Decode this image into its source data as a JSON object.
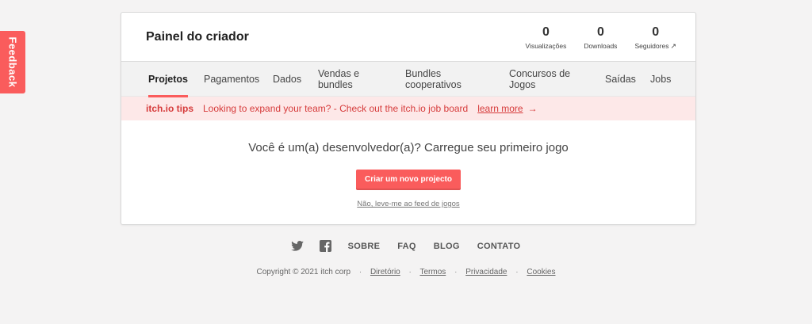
{
  "feedback": {
    "label": "Feedback"
  },
  "header": {
    "title": "Painel do criador",
    "stats": [
      {
        "value": "0",
        "label": "Visualizações"
      },
      {
        "value": "0",
        "label": "Downloads"
      },
      {
        "value": "0",
        "label": "Seguidores"
      }
    ],
    "followers_arrow": "↗"
  },
  "tabs": [
    {
      "label": "Projetos"
    },
    {
      "label": "Pagamentos"
    },
    {
      "label": "Dados"
    },
    {
      "label": "Vendas e bundles"
    },
    {
      "label": "Bundles cooperativos"
    },
    {
      "label": "Concursos de Jogos"
    },
    {
      "label": "Saídas"
    },
    {
      "label": "Jobs"
    }
  ],
  "tips": {
    "label": "itch.io tips",
    "text": "Looking to expand your team? - Check out the itch.io job board",
    "link": "learn more",
    "arrow": "→"
  },
  "main": {
    "heading": "Você é um(a) desenvolvedor(a)? Carregue seu primeiro jogo",
    "create_button": "Criar um novo projecto",
    "skip_link": "Não, leve-me ao feed de jogos"
  },
  "footer": {
    "links": [
      "SOBRE",
      "FAQ",
      "BLOG",
      "CONTATO"
    ],
    "copyright": "Copyright © 2021 itch corp",
    "legal_links": [
      "Diretório",
      "Termos",
      "Privacidade",
      "Cookies"
    ],
    "separator": "·"
  },
  "colors": {
    "accent": "#fa5c5c",
    "tips_bg": "#fde8e8",
    "page_bg": "#f4f3f3"
  }
}
